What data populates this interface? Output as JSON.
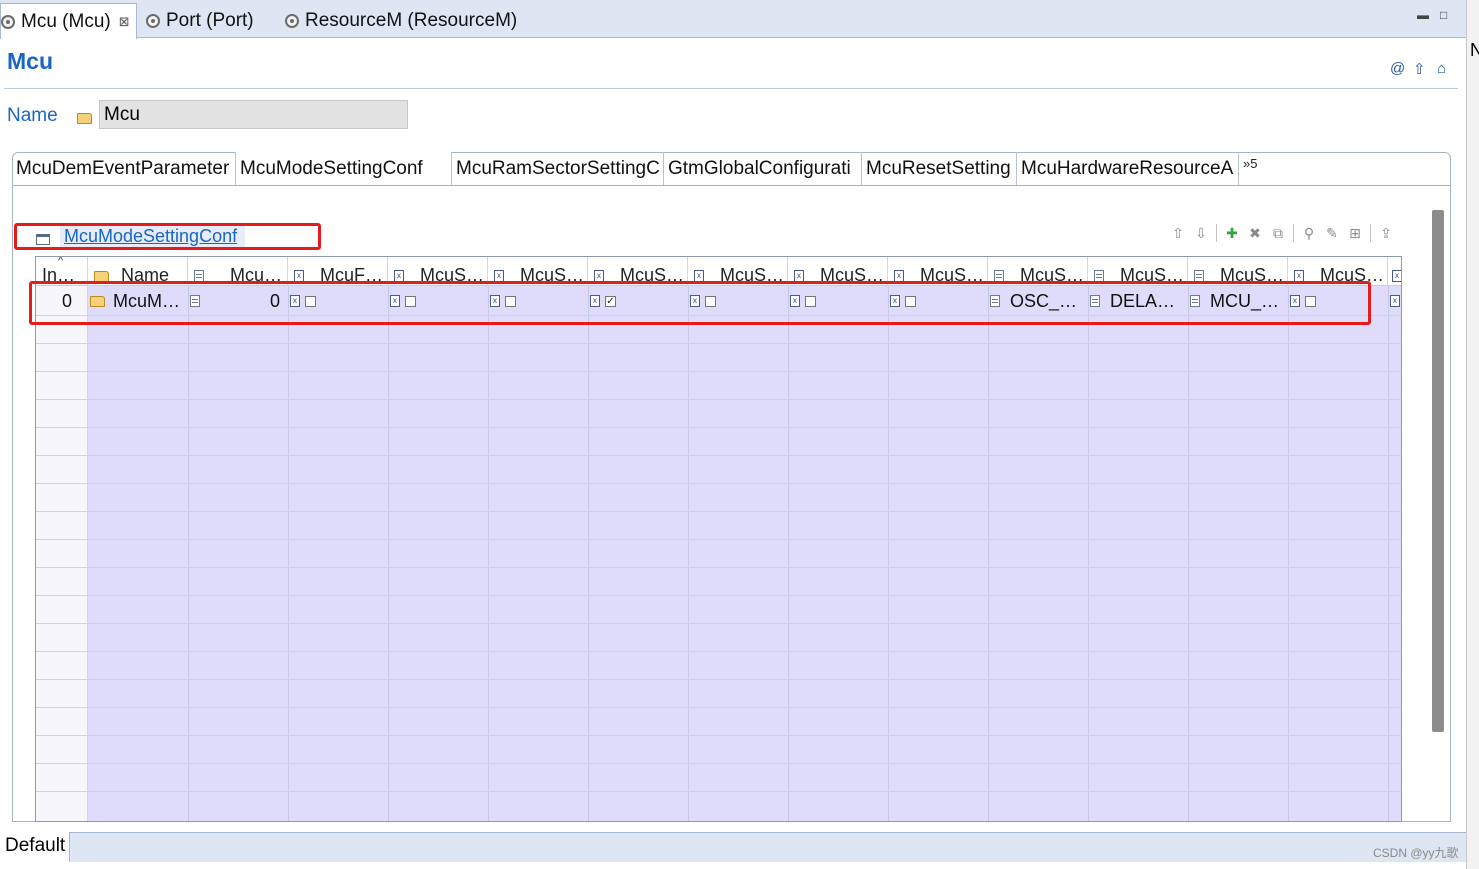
{
  "editor_tabs": [
    {
      "label": "Mcu (Mcu)",
      "active": true,
      "closable": true
    },
    {
      "label": "Port (Port)",
      "active": false
    },
    {
      "label": "ResourceM (ResourceM)",
      "active": false
    }
  ],
  "window_controls": {
    "minimize": "▬",
    "maximize": "□"
  },
  "right_edge_char": "N",
  "form": {
    "title": "Mcu",
    "header_icons": [
      "@",
      "⇧",
      "⌂"
    ],
    "name_label": "Name",
    "name_value": "Mcu"
  },
  "sub_tabs": [
    {
      "label": "McuDemEventParameter",
      "active": false
    },
    {
      "label": "McuModeSettingConf",
      "active": true
    },
    {
      "label": "McuRamSectorSettingC",
      "active": false
    },
    {
      "label": "GtmGlobalConfigurati",
      "active": false
    },
    {
      "label": "McuResetSetting",
      "active": false
    },
    {
      "label": "McuHardwareResourceA",
      "active": false
    }
  ],
  "sub_tabs_more": "»5",
  "section": {
    "title": "McuModeSettingConf"
  },
  "toolbar": [
    "⇧",
    "⇩",
    "✚",
    "✖",
    "⧉",
    "⚲",
    "✎",
    "⊞",
    "⇪"
  ],
  "table": {
    "headers": [
      "In…",
      "Name",
      "Mcu…",
      "McuF…",
      "McuS…",
      "McuS…",
      "McuS…",
      "McuS…",
      "McuS…",
      "McuS…",
      "McuS…",
      "McuS…",
      "McuS…",
      "McuS…"
    ],
    "row": {
      "index": "0",
      "name": "McuM…",
      "mcu_value": "0",
      "checks": [
        false,
        false,
        false,
        true,
        false,
        false,
        false
      ],
      "text_values": [
        "OSC_…",
        "DELA…",
        "MCU_…"
      ],
      "last_check": false
    }
  },
  "bottom": {
    "tab": "Default"
  },
  "watermark": "CSDN @yy九歌",
  "colors": {
    "accent": "#1a66c2",
    "highlight": "#e61b1b",
    "grid_bg": "#dedcfa"
  }
}
